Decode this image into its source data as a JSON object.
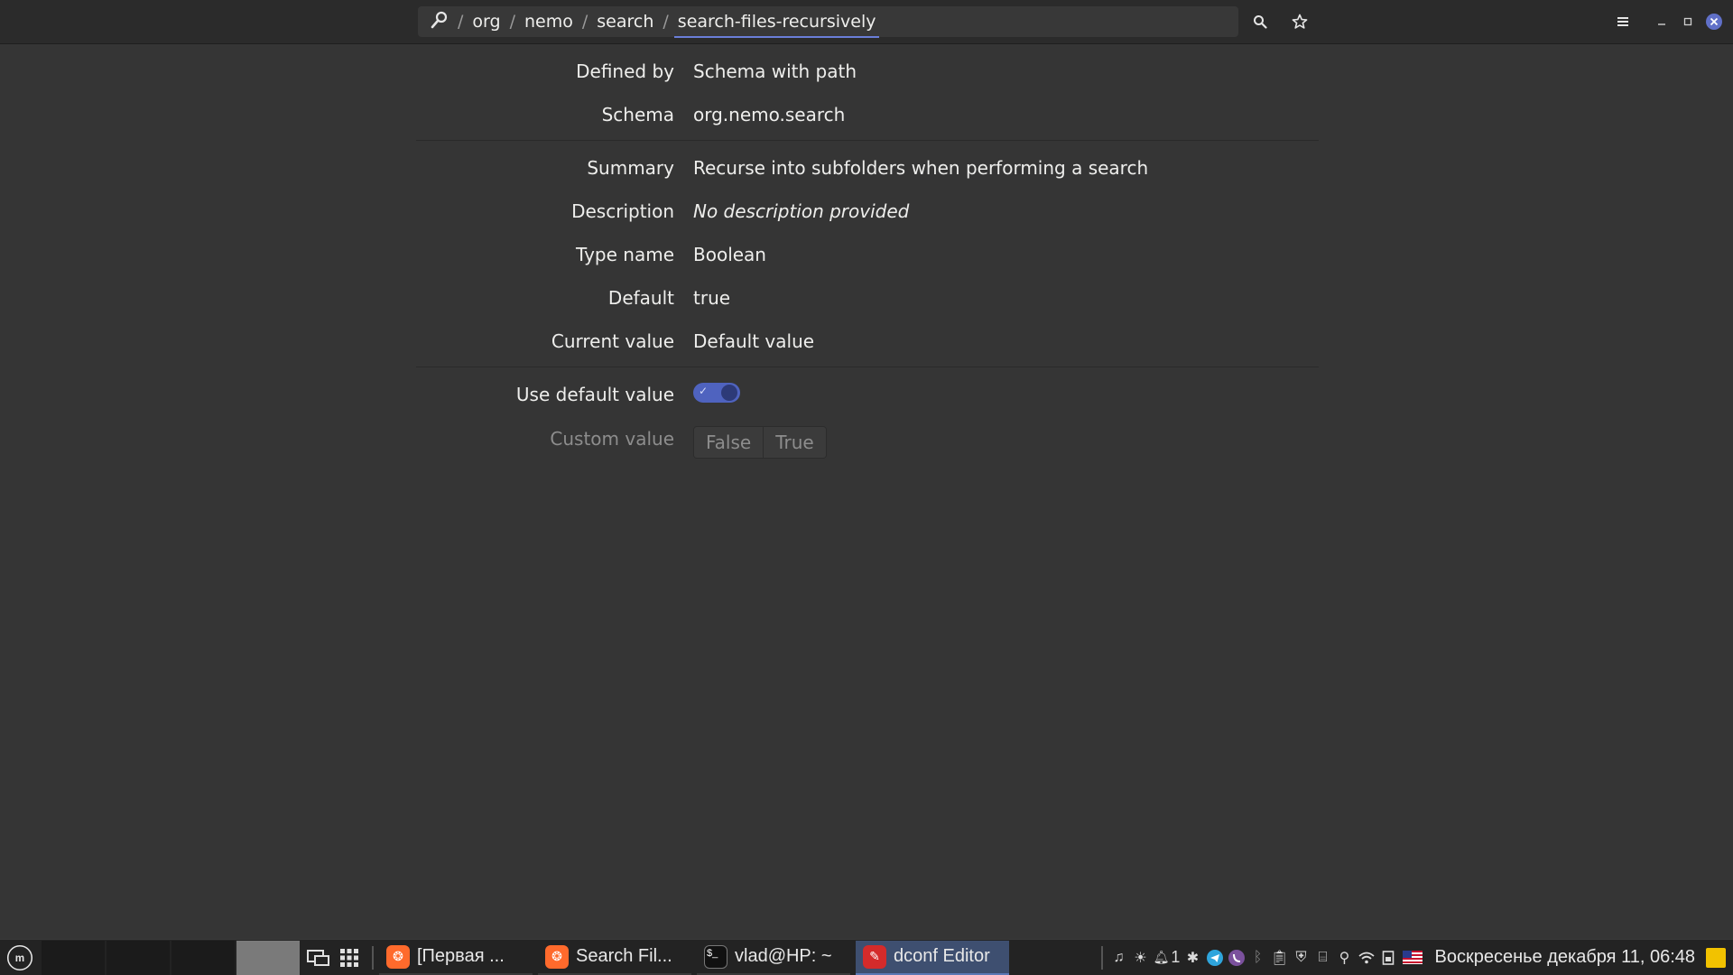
{
  "header": {
    "path": [
      "org",
      "nemo",
      "search",
      "search-files-recursively"
    ],
    "separator": "/"
  },
  "details": [
    {
      "label": "Defined by",
      "value": "Schema with path"
    },
    {
      "label": "Schema",
      "value": "org.nemo.search"
    },
    {
      "label": "Summary",
      "value": "Recurse into subfolders when performing a search"
    },
    {
      "label": "Description",
      "value": "No description provided"
    },
    {
      "label": "Type name",
      "value": "Boolean"
    },
    {
      "label": "Default",
      "value": "true"
    },
    {
      "label": "Current value",
      "value": "Default value"
    }
  ],
  "use_default": {
    "label": "Use default value",
    "enabled": true
  },
  "custom": {
    "label": "Custom value",
    "options": [
      "False",
      "True"
    ]
  },
  "taskbar": {
    "tasks": [
      {
        "label": "[Первая ...",
        "icon": "firefox-icon",
        "active": false
      },
      {
        "label": "Search Fil...",
        "icon": "firefox-icon",
        "active": false
      },
      {
        "label": "vlad@HP: ~",
        "icon": "terminal-icon",
        "active": false
      },
      {
        "label": "dconf Editor",
        "icon": "dconf-editor-icon",
        "active": true
      }
    ],
    "notification_count": "1",
    "clock": "Воскресенье декабря 11, 06:48"
  },
  "colors": {
    "accent": "#4f63bf",
    "background": "#353535",
    "taskbar": "#232323"
  }
}
